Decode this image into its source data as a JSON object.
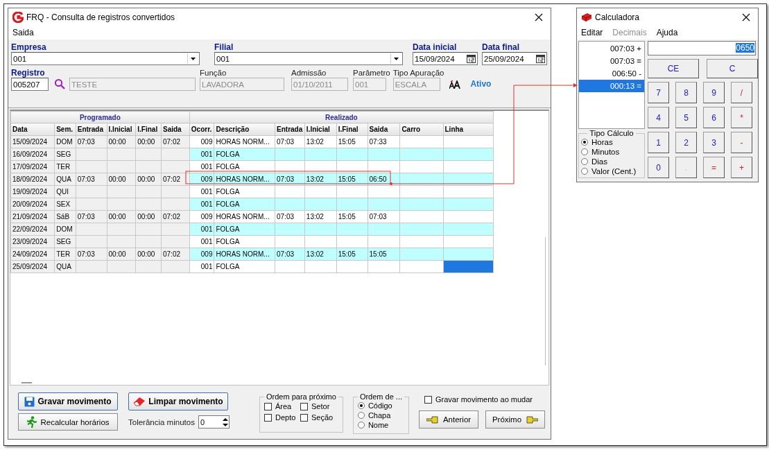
{
  "window": {
    "title": "FRQ - Consulta de registros convertidos"
  },
  "menu": [
    "Saida"
  ],
  "filters": [
    {
      "kind": "combo",
      "label": "Empresa",
      "value": "001"
    },
    {
      "kind": "combo",
      "label": "Filial",
      "value": "001"
    },
    {
      "kind": "date",
      "label": "Data inicial",
      "value": "15/09/2024"
    },
    {
      "kind": "date",
      "label": "Data final",
      "value": "25/09/2024"
    }
  ],
  "employee": {
    "registro": {
      "label": "Registro",
      "value": "005207"
    },
    "name": "TESTE",
    "fields": [
      {
        "label": "Função",
        "value": "LAVADORA"
      },
      {
        "label": "Admissão",
        "value": "01/10/2011"
      },
      {
        "label": "Parâmetro",
        "value": "001"
      },
      {
        "label": "Tipo Apuração",
        "value": "ESCALA"
      }
    ],
    "status": "Ativo"
  },
  "table": {
    "groups": [
      "Programado",
      "Realizado"
    ],
    "columns": [
      "Data",
      "Sem.",
      "Entrada",
      "I.Inicial",
      "I.Final",
      "Saida",
      "Ocorr.",
      "Descrição",
      "Entrada",
      "I.Inicial",
      "I.Final",
      "Saida",
      "Carro",
      "Linha"
    ],
    "rows": [
      {
        "cells": [
          "15/09/2024",
          "DOM",
          "07:03",
          "00:00",
          "00:00",
          "07:02",
          "009",
          "HORAS NORM...",
          "07:03",
          "13:02",
          "15:05",
          "07:33",
          "",
          ""
        ],
        "highlighted": false,
        "selected": false
      },
      {
        "cells": [
          "16/09/2024",
          "SEG",
          "",
          "",
          "",
          "",
          "001",
          "FOLGA",
          "",
          "",
          "",
          "",
          "",
          ""
        ],
        "highlighted": true,
        "selected": false
      },
      {
        "cells": [
          "17/09/2024",
          "TER",
          "",
          "",
          "",
          "",
          "001",
          "FOLGA",
          "",
          "",
          "",
          "",
          "",
          ""
        ],
        "highlighted": false,
        "selected": false
      },
      {
        "cells": [
          "18/09/2024",
          "QUA",
          "07:03",
          "00:00",
          "00:00",
          "07:02",
          "009",
          "HORAS NORM...",
          "07:03",
          "13:02",
          "15:05",
          "06:50",
          "",
          ""
        ],
        "highlighted": true,
        "selected": false
      },
      {
        "cells": [
          "19/09/2024",
          "QUI",
          "",
          "",
          "",
          "",
          "001",
          "FOLGA",
          "",
          "",
          "",
          "",
          "",
          ""
        ],
        "highlighted": false,
        "selected": false
      },
      {
        "cells": [
          "20/09/2024",
          "SEX",
          "",
          "",
          "",
          "",
          "001",
          "FOLGA",
          "",
          "",
          "",
          "",
          "",
          ""
        ],
        "highlighted": true,
        "selected": false
      },
      {
        "cells": [
          "21/09/2024",
          "SáB",
          "07:03",
          "00:00",
          "00:00",
          "07:02",
          "009",
          "HORAS NORM...",
          "07:03",
          "13:02",
          "15:05",
          "07:03",
          "",
          ""
        ],
        "highlighted": false,
        "selected": false
      },
      {
        "cells": [
          "22/09/2024",
          "DOM",
          "",
          "",
          "",
          "",
          "001",
          "FOLGA",
          "",
          "",
          "",
          "",
          "",
          ""
        ],
        "highlighted": true,
        "selected": false
      },
      {
        "cells": [
          "23/09/2024",
          "SEG",
          "",
          "",
          "",
          "",
          "001",
          "FOLGA",
          "",
          "",
          "",
          "",
          "",
          ""
        ],
        "highlighted": false,
        "selected": false
      },
      {
        "cells": [
          "24/09/2024",
          "TER",
          "07:03",
          "00:00",
          "00:00",
          "07:02",
          "009",
          "HORAS NORM...",
          "07:03",
          "13:02",
          "15:05",
          "15:05",
          "",
          ""
        ],
        "highlighted": true,
        "selected": false
      },
      {
        "cells": [
          "25/09/2024",
          "QUA",
          "",
          "",
          "",
          "",
          "001",
          "FOLGA",
          "",
          "",
          "",
          "",
          "",
          ""
        ],
        "highlighted": false,
        "selected": true
      }
    ]
  },
  "footer": {
    "save_button": "Gravar movimento",
    "clear_button": "Limpar movimento",
    "recalc_button": "Recalcular horários",
    "tolerance": {
      "label": "Tolerância minutos",
      "value": "0"
    },
    "order_next": {
      "title": "Ordem para próximo",
      "options": [
        {
          "label": "Área",
          "checked": false
        },
        {
          "label": "Setor",
          "checked": false
        },
        {
          "label": "Depto",
          "checked": false
        },
        {
          "label": "Seção",
          "checked": false
        }
      ]
    },
    "order_by": {
      "title": "Ordem de ...",
      "options": [
        {
          "label": "Código",
          "selected": true
        },
        {
          "label": "Chapa",
          "selected": false
        },
        {
          "label": "Nome",
          "selected": false
        }
      ]
    },
    "save_on_change": {
      "label": "Gravar movimento ao mudar",
      "checked": false
    },
    "prev_button": "Anterior",
    "next_button": "Próximo"
  },
  "calculator": {
    "title": "Calculadora",
    "menu": [
      {
        "label": "Editar",
        "disabled": false
      },
      {
        "label": "Decimais",
        "disabled": true
      },
      {
        "label": "Ajuda",
        "disabled": false
      }
    ],
    "tape": [
      {
        "text": "007:03 +",
        "selected": false
      },
      {
        "text": "007:03 =",
        "selected": false
      },
      {
        "text": "006:50 -",
        "selected": false
      },
      {
        "text": "000:13 =",
        "selected": true
      }
    ],
    "display": "0650",
    "calc_type": {
      "title": "Tipo Cálculo",
      "options": [
        {
          "label": "Horas",
          "selected": true
        },
        {
          "label": "Minutos",
          "selected": false
        },
        {
          "label": "Dias",
          "selected": false
        },
        {
          "label": "Valor (Cent.)",
          "selected": false
        }
      ]
    },
    "keys": [
      {
        "label": "CE",
        "kind": "clear"
      },
      {
        "label": "C",
        "kind": "clear"
      },
      {
        "label": "7",
        "kind": "digit"
      },
      {
        "label": "8",
        "kind": "digit"
      },
      {
        "label": "9",
        "kind": "digit"
      },
      {
        "label": "/",
        "kind": "op"
      },
      {
        "label": "4",
        "kind": "digit"
      },
      {
        "label": "5",
        "kind": "digit"
      },
      {
        "label": "6",
        "kind": "digit"
      },
      {
        "label": "*",
        "kind": "op"
      },
      {
        "label": "1",
        "kind": "digit"
      },
      {
        "label": "2",
        "kind": "digit"
      },
      {
        "label": "3",
        "kind": "digit"
      },
      {
        "label": "-",
        "kind": "op"
      },
      {
        "label": "0",
        "kind": "digit"
      },
      {
        "label": ".",
        "kind": "disabled"
      },
      {
        "label": "=",
        "kind": "op"
      },
      {
        "label": "+",
        "kind": "op"
      }
    ]
  }
}
